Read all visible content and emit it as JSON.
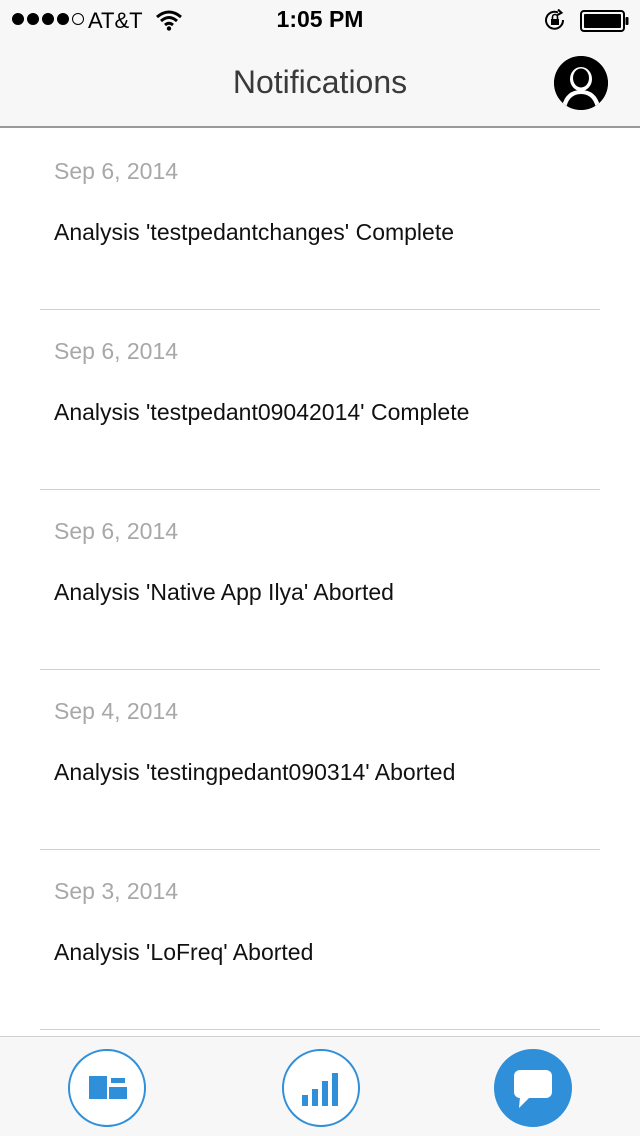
{
  "status_bar": {
    "carrier": "AT&T",
    "time": "1:05 PM",
    "signal_bars": 4,
    "signal_max": 5,
    "icons": [
      "wifi-icon",
      "orientation-lock-icon",
      "battery-icon"
    ]
  },
  "nav": {
    "title": "Notifications",
    "profile_icon": "user-silhouette-icon"
  },
  "notifications": [
    {
      "date": "Sep 6, 2014",
      "message": "Analysis 'testpedantchanges' Complete"
    },
    {
      "date": "Sep 6, 2014",
      "message": "Analysis 'testpedant09042014' Complete"
    },
    {
      "date": "Sep 6, 2014",
      "message": "Analysis 'Native App Ilya' Aborted"
    },
    {
      "date": "Sep 4, 2014",
      "message": "Analysis 'testingpedant090314' Aborted"
    },
    {
      "date": "Sep 3, 2014",
      "message": "Analysis 'LoFreq' Aborted"
    }
  ],
  "tab_bar": {
    "tabs": [
      {
        "icon": "dashboard-icon",
        "active": false
      },
      {
        "icon": "bar-chart-icon",
        "active": false
      },
      {
        "icon": "chat-bubble-icon",
        "active": true
      }
    ]
  },
  "colors": {
    "accent": "#2f8fd8",
    "bar_background": "#f7f7f7",
    "date_text": "#a8a8a8",
    "divider": "#cfcfcf"
  }
}
